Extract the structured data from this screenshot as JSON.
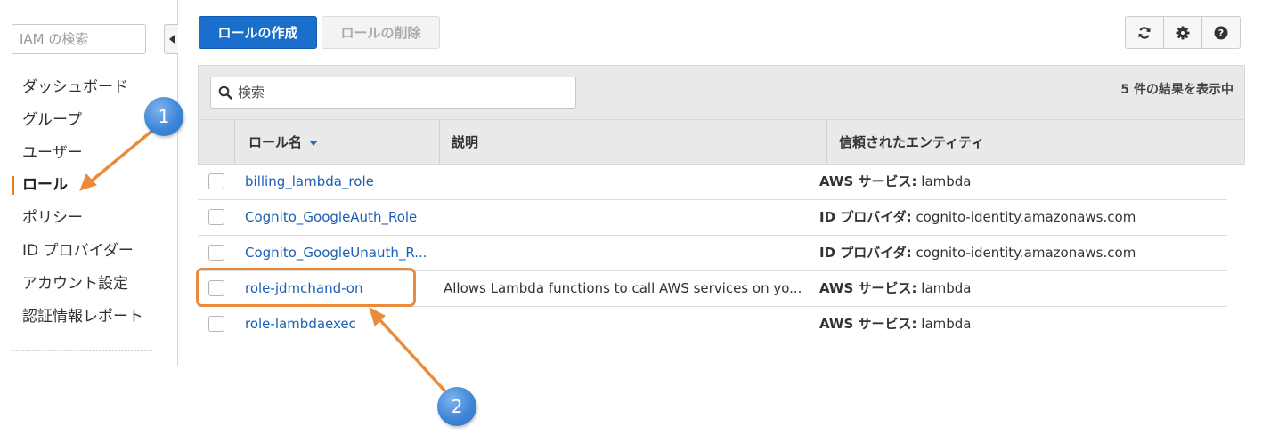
{
  "sidebar": {
    "search_placeholder": "IAM の検索",
    "items": [
      {
        "label": "ダッシュボード"
      },
      {
        "label": "グループ"
      },
      {
        "label": "ユーザー"
      },
      {
        "label": "ロール",
        "active": true
      },
      {
        "label": "ポリシー"
      },
      {
        "label": "ID プロバイダー"
      },
      {
        "label": "アカウント設定"
      },
      {
        "label": "認証情報レポート"
      }
    ]
  },
  "toolbar": {
    "create_label": "ロールの作成",
    "delete_label": "ロールの削除",
    "icons": [
      "refresh-icon",
      "gear-icon",
      "help-icon"
    ]
  },
  "table": {
    "filter_placeholder": "検索",
    "result_count": "5 件の結果を表示中",
    "columns": [
      "ロール名",
      "説明",
      "信頼されたエンティティ"
    ],
    "rows": [
      {
        "name": "billing_lambda_role",
        "description": "",
        "entity_label": "AWS サービス:",
        "entity_value": "lambda"
      },
      {
        "name": "Cognito_GoogleAuth_Role",
        "description": "",
        "entity_label": "ID プロバイダ:",
        "entity_value": "cognito-identity.amazonaws.com"
      },
      {
        "name": "Cognito_GoogleUnauth_R...",
        "description": "",
        "entity_label": "ID プロバイダ:",
        "entity_value": "cognito-identity.amazonaws.com"
      },
      {
        "name": "role-jdmchand-on",
        "description": "Allows Lambda functions to call AWS services on yo...",
        "entity_label": "AWS サービス:",
        "entity_value": "lambda"
      },
      {
        "name": "role-lambdaexec",
        "description": "",
        "entity_label": "AWS サービス:",
        "entity_value": "lambda"
      }
    ]
  },
  "annotations": {
    "badge1": "1",
    "badge2": "2",
    "accent_color": "#ea8a3a",
    "badge_color": "#3f86d8"
  }
}
